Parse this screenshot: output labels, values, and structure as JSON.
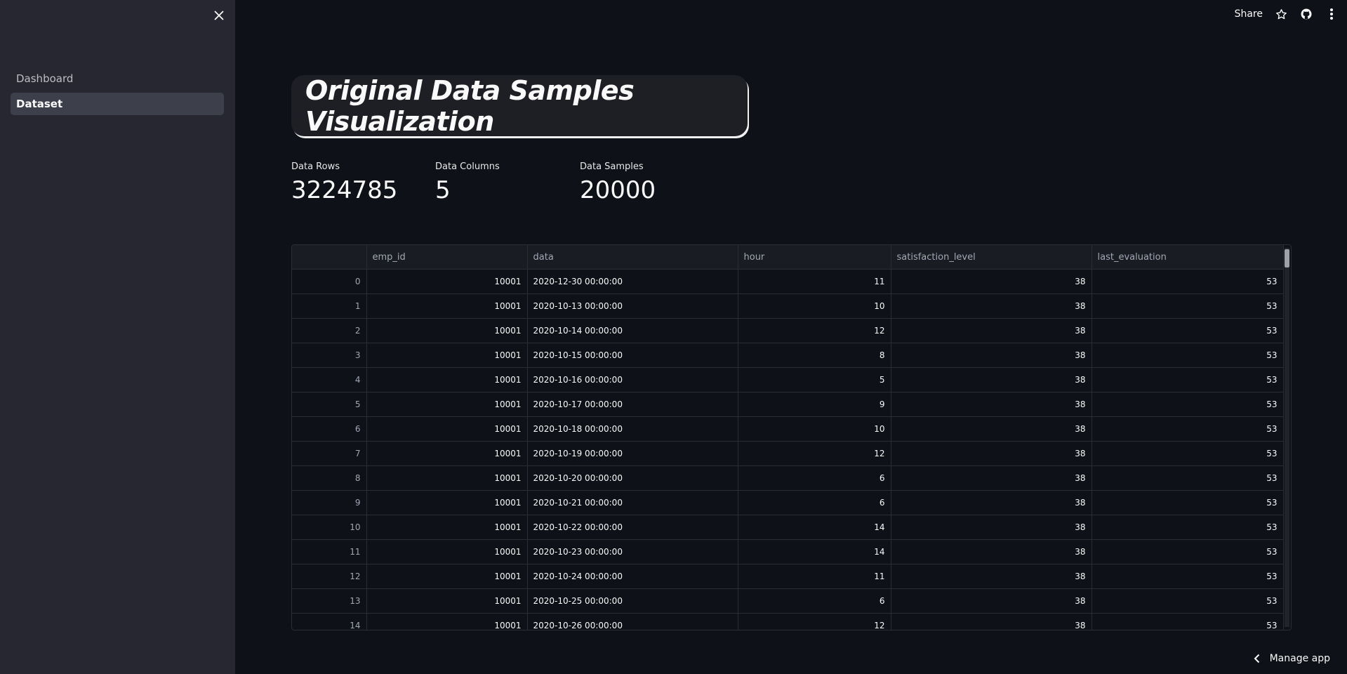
{
  "sidebar": {
    "items": [
      {
        "label": "Dashboard",
        "active": false
      },
      {
        "label": "Dataset",
        "active": true
      }
    ]
  },
  "header": {
    "share_label": "Share"
  },
  "main": {
    "title": "Original Data Samples Visualization",
    "metrics": [
      {
        "label": "Data Rows",
        "value": "3224785"
      },
      {
        "label": "Data Columns",
        "value": "5"
      },
      {
        "label": "Data Samples",
        "value": "20000"
      }
    ],
    "table": {
      "columns": [
        "",
        "emp_id",
        "data",
        "hour",
        "satisfaction_level",
        "last_evaluation"
      ],
      "rows": [
        [
          "0",
          "10001",
          "2020-12-30 00:00:00",
          "11",
          "38",
          "53"
        ],
        [
          "1",
          "10001",
          "2020-10-13 00:00:00",
          "10",
          "38",
          "53"
        ],
        [
          "2",
          "10001",
          "2020-10-14 00:00:00",
          "12",
          "38",
          "53"
        ],
        [
          "3",
          "10001",
          "2020-10-15 00:00:00",
          "8",
          "38",
          "53"
        ],
        [
          "4",
          "10001",
          "2020-10-16 00:00:00",
          "5",
          "38",
          "53"
        ],
        [
          "5",
          "10001",
          "2020-10-17 00:00:00",
          "9",
          "38",
          "53"
        ],
        [
          "6",
          "10001",
          "2020-10-18 00:00:00",
          "10",
          "38",
          "53"
        ],
        [
          "7",
          "10001",
          "2020-10-19 00:00:00",
          "12",
          "38",
          "53"
        ],
        [
          "8",
          "10001",
          "2020-10-20 00:00:00",
          "6",
          "38",
          "53"
        ],
        [
          "9",
          "10001",
          "2020-10-21 00:00:00",
          "6",
          "38",
          "53"
        ],
        [
          "10",
          "10001",
          "2020-10-22 00:00:00",
          "14",
          "38",
          "53"
        ],
        [
          "11",
          "10001",
          "2020-10-23 00:00:00",
          "14",
          "38",
          "53"
        ],
        [
          "12",
          "10001",
          "2020-10-24 00:00:00",
          "11",
          "38",
          "53"
        ],
        [
          "13",
          "10001",
          "2020-10-25 00:00:00",
          "6",
          "38",
          "53"
        ],
        [
          "14",
          "10001",
          "2020-10-26 00:00:00",
          "12",
          "38",
          "53"
        ]
      ]
    }
  },
  "footer": {
    "manage_app_label": "Manage app"
  },
  "icons": {
    "close": "close-icon",
    "star": "star-icon",
    "github": "github-icon",
    "menu": "more-vertical-icon",
    "chevron": "chevron-left-icon"
  }
}
